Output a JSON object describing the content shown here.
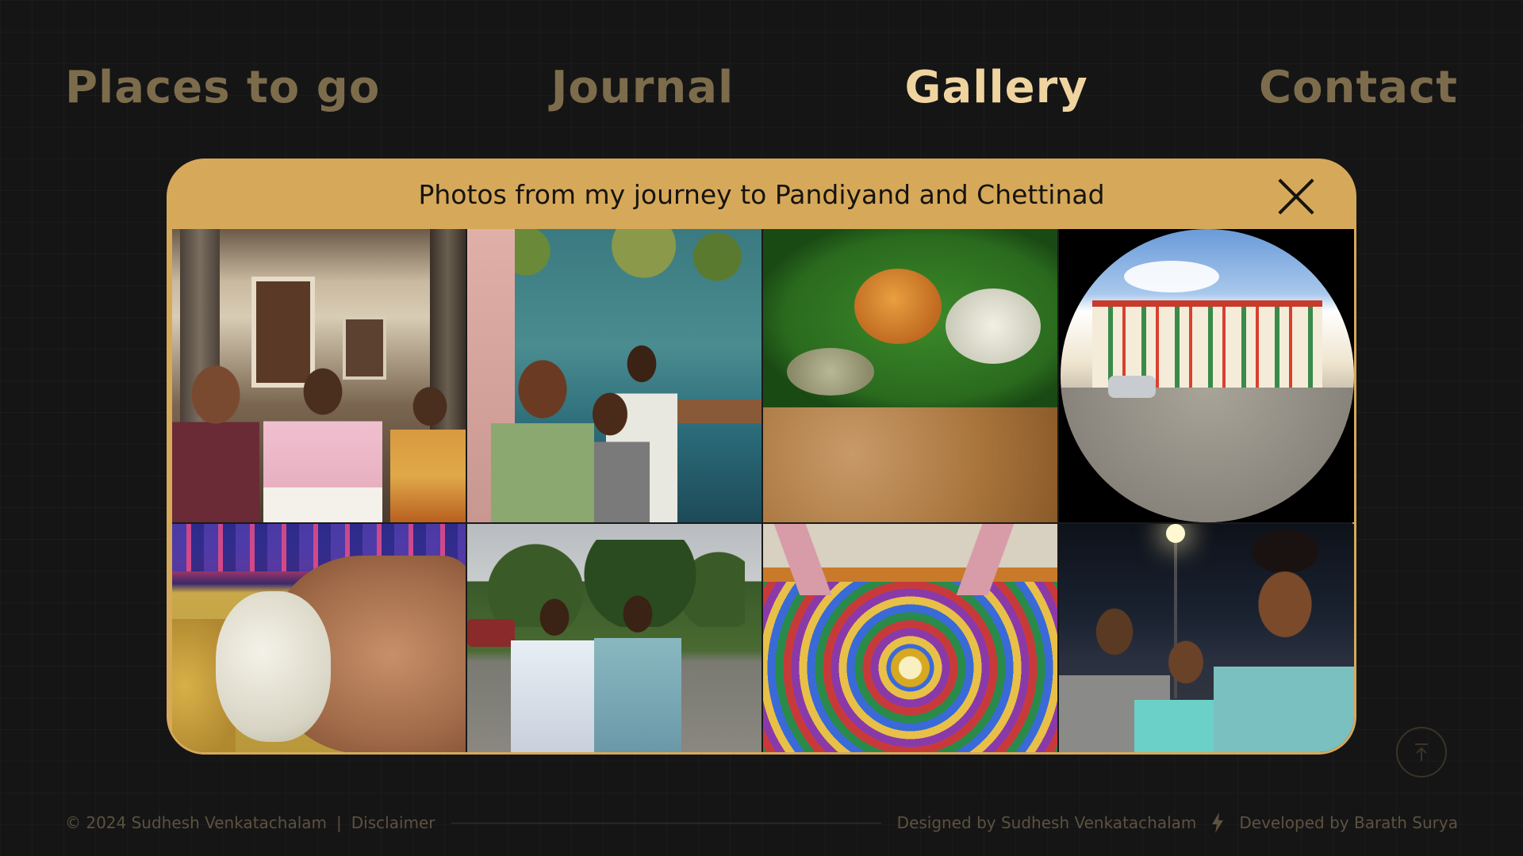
{
  "nav": {
    "items": [
      {
        "label": "Places to go",
        "active": false
      },
      {
        "label": "Journal",
        "active": false
      },
      {
        "label": "Gallery",
        "active": true
      },
      {
        "label": "Contact",
        "active": false
      }
    ]
  },
  "modal": {
    "title": "Photos from my journey to Pandiyand and Chettinad",
    "close_icon": "close-icon",
    "photos_count": 8
  },
  "footer": {
    "copyright": "© 2024 Sudhesh Venkatachalam",
    "separator": "|",
    "disclaimer": "Disclaimer",
    "designed_by": "Designed by Sudhesh Venkatachalam",
    "developed_by": "Developed by Barath Surya",
    "bolt_icon": "lightning-bolt-icon"
  },
  "back_to_top": {
    "icon": "arrow-up-to-top-icon"
  },
  "colors": {
    "background": "#151515",
    "nav_inactive": "#7d6c4c",
    "nav_active": "#f0d4a0",
    "modal_header": "#d6a95a",
    "footer_text": "#5c5240"
  }
}
